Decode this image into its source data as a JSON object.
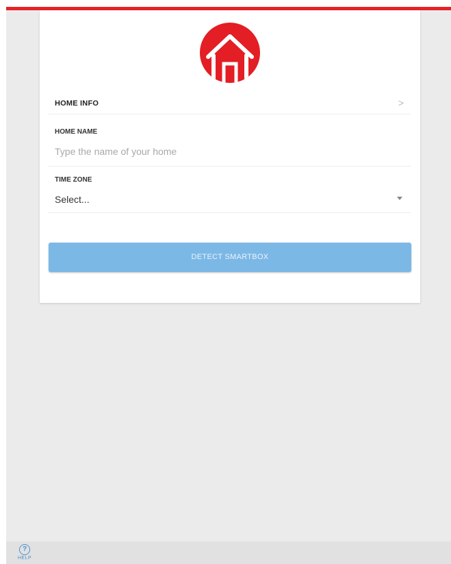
{
  "colors": {
    "accent": "#e52228",
    "logo_bg": "#e31e24",
    "button_bg": "#7cb8e6",
    "help_blue": "#4a8fd0",
    "screen_bg": "#ebebeb"
  },
  "logo": {
    "icon": "house-icon"
  },
  "home_info": {
    "label": "HOME INFO",
    "chevron_icon": "chevron-right-icon",
    "chevron_glyph": ">"
  },
  "home_name": {
    "label": "HOME NAME",
    "value": "",
    "placeholder": "Type the name of your home"
  },
  "time_zone": {
    "label": "TIME ZONE",
    "selected": "Select...",
    "caret_icon": "caret-down-icon"
  },
  "actions": {
    "detect_label": "DETECT SMARTBOX"
  },
  "footer": {
    "help_icon": "question-circle-icon",
    "help_glyph": "?",
    "help_label": "HELP"
  }
}
